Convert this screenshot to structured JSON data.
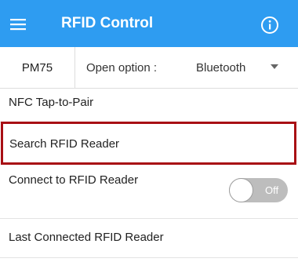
{
  "app_bar": {
    "title": "RFID Control",
    "background_color": "#2e9cf1",
    "menu_icon": "hamburger-menu-icon",
    "info_icon": "info-circle-icon"
  },
  "options_row": {
    "device_model": "PM75",
    "open_option_label": "Open option :",
    "open_option_selected": "Bluetooth",
    "dropdown_icon": "triangle-down-icon"
  },
  "list": {
    "nfc_tap_to_pair": "NFC Tap-to-Pair",
    "search_rfid_reader": "Search RFID Reader",
    "connect_to_rfid_reader": "Connect to RFID Reader",
    "last_connected_rfid_reader": "Last Connected RFID Reader"
  },
  "toggle": {
    "state_label": "Off",
    "is_on": false
  },
  "highlight_color": "#a80f14"
}
